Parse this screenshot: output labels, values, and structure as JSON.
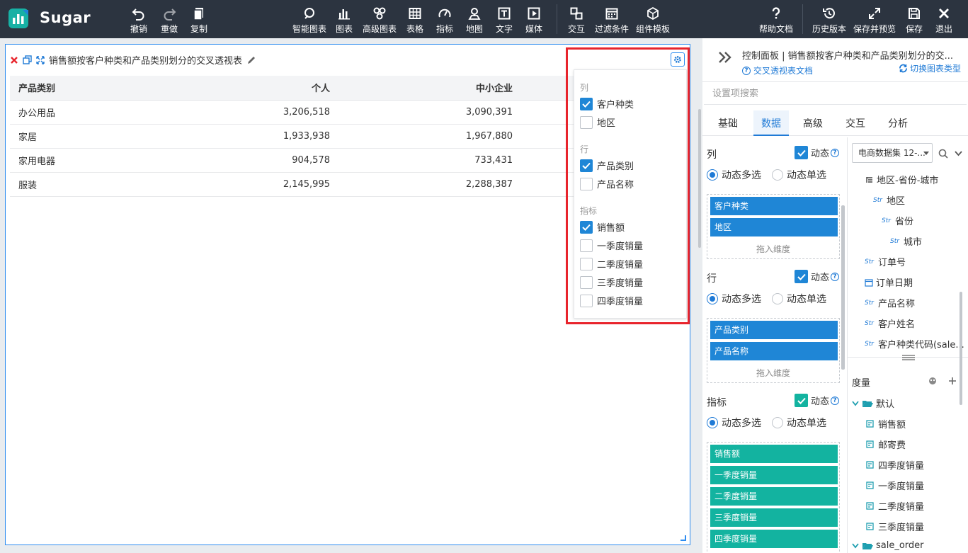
{
  "app": {
    "brand": "Sugar"
  },
  "toolbar": {
    "undo": "撤销",
    "redo": "重做",
    "copy": "复制",
    "smart_chart": "智能图表",
    "chart": "图表",
    "advanced_chart": "高级图表",
    "table": "表格",
    "metric": "指标",
    "map": "地图",
    "text": "文字",
    "media": "媒体",
    "interaction": "交互",
    "filter": "过滤条件",
    "component_template": "组件模板",
    "help": "帮助文档",
    "history": "历史版本",
    "save_preview": "保存并预览",
    "save": "保存",
    "exit": "退出"
  },
  "chart": {
    "title": "销售额按客户种类和产品类别划分的交叉透视表",
    "headers": [
      "产品类别",
      "个人",
      "中小企业"
    ],
    "rows": [
      [
        "办公用品",
        "3,206,518",
        "3,090,391"
      ],
      [
        "家居",
        "1,933,938",
        "1,967,880"
      ],
      [
        "家用电器",
        "904,578",
        "733,431"
      ],
      [
        "服装",
        "2,145,995",
        "2,288,387"
      ]
    ]
  },
  "dropdown": {
    "col_label": "列",
    "col_options": [
      {
        "label": "客户种类",
        "checked": true
      },
      {
        "label": "地区",
        "checked": false
      }
    ],
    "row_label": "行",
    "row_options": [
      {
        "label": "产品类别",
        "checked": true
      },
      {
        "label": "产品名称",
        "checked": false
      }
    ],
    "metric_label": "指标",
    "metric_options": [
      {
        "label": "销售额",
        "checked": true
      },
      {
        "label": "一季度销量",
        "checked": false
      },
      {
        "label": "二季度销量",
        "checked": false
      },
      {
        "label": "三季度销量",
        "checked": false
      },
      {
        "label": "四季度销量",
        "checked": false
      }
    ]
  },
  "panel": {
    "title": "控制面板 | 销售额按客户种类和产品类别划分的交...",
    "doc_link": "交叉透视表文档",
    "switch_type": "切换图表类型",
    "search_placeholder": "设置项搜索",
    "tabs": [
      "基础",
      "数据",
      "高级",
      "交互",
      "分析"
    ],
    "active_tab": "数据",
    "col_section": "列",
    "row_section": "行",
    "metric_section": "指标",
    "dynamic": "动态",
    "multi": "动态多选",
    "single": "动态单选",
    "drop_hint": "拖入维度",
    "col_chips": [
      "客户种类",
      "地区"
    ],
    "row_chips": [
      "产品类别",
      "产品名称"
    ],
    "metric_chips": [
      "销售额",
      "一季度销量",
      "二季度销量",
      "三季度销量",
      "四季度销量"
    ]
  },
  "fields": {
    "dataset": "电商数据集 12-...",
    "type_tag": "Str",
    "dims": {
      "hierarchy": "地区-省份-城市",
      "region": "地区",
      "province": "省份",
      "city": "城市",
      "order_no": "订单号",
      "order_date": "订单日期",
      "product_name": "产品名称",
      "customer_name": "客户姓名",
      "customer_code": "客户种类代码(sale..."
    },
    "measure_label": "度量",
    "default_group": "默认",
    "measures": [
      "销售额",
      "邮寄费",
      "四季度销量",
      "一季度销量",
      "二季度销量",
      "三季度销量"
    ],
    "second_group": "sale_order"
  },
  "colors": {
    "accent": "#1f86d6",
    "metric_chip": "#13b3a0",
    "highlight_box": "#e8242c",
    "topbar": "#2c3440"
  }
}
